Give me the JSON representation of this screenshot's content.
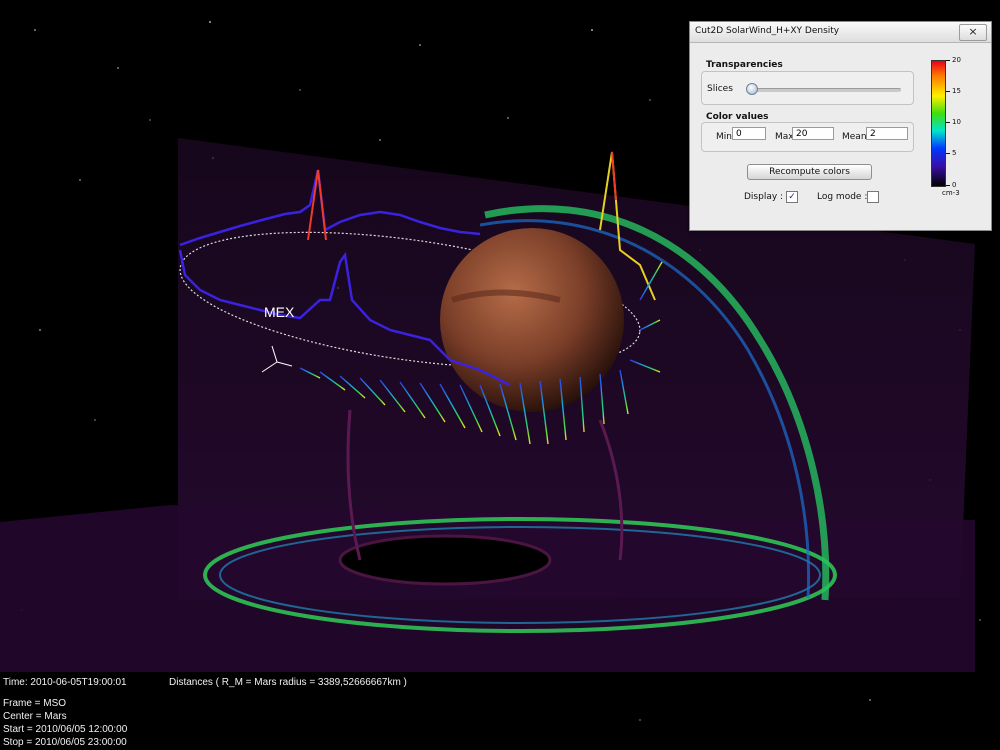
{
  "scene": {
    "spacecraft_label": "MEX",
    "colors": {
      "density_low": "#3a18d8",
      "density_high": "#ff1c1c",
      "planet": "#8a4a30",
      "shock": "#22c060"
    }
  },
  "hud": {
    "time": "Time: 2010-06-05T19:00:01",
    "distances": "Distances ( R_M = Mars radius = 3389,52666667km )",
    "frame": "Frame = MSO",
    "center": "Center = Mars",
    "start": "Start = 2010/06/05 12:00:00",
    "stop": "Stop = 2010/06/05 23:00:00"
  },
  "panel": {
    "title": "Cut2D SolarWind_H+XY Density",
    "close_icon": "×",
    "transparencies": {
      "heading": "Transparencies",
      "slices_label": "Slices",
      "slices_value": 0.0
    },
    "color_values": {
      "heading": "Color values",
      "min_label": "Min",
      "min_value": "0",
      "max_label": "Max",
      "max_value": "20",
      "mean_label": "Mean",
      "mean_value": "2"
    },
    "recompute_label": "Recompute colors",
    "display_label": "Display :",
    "display_checked": "✓",
    "logmode_label": "Log mode :",
    "logmode_checked": "",
    "colorbar": {
      "ticks": [
        "20",
        "15",
        "10",
        "5",
        "0"
      ],
      "unit": "cm-3"
    }
  }
}
